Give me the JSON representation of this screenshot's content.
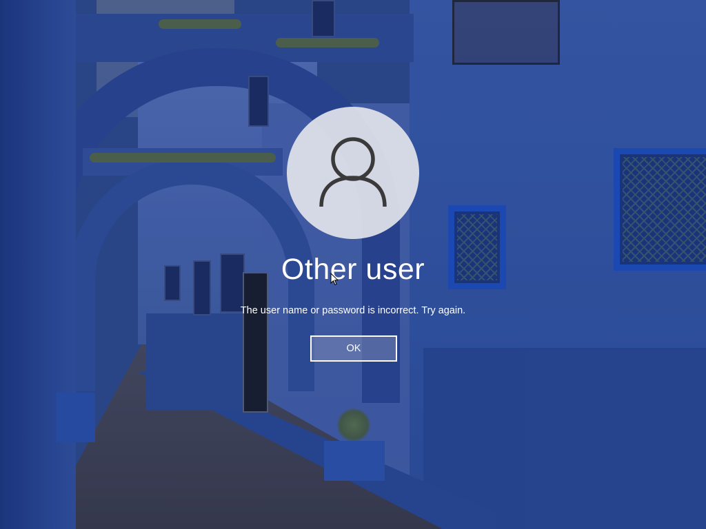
{
  "user": {
    "name": "Other user",
    "avatar_icon": "user-icon"
  },
  "dialog": {
    "message": "The user name or password is incorrect. Try again.",
    "ok_label": "OK"
  },
  "colors": {
    "text": "#ffffff",
    "avatar_bg": "#e2e4ea",
    "avatar_glyph": "#3a3a3a",
    "background_blue": "#2f4f93"
  }
}
